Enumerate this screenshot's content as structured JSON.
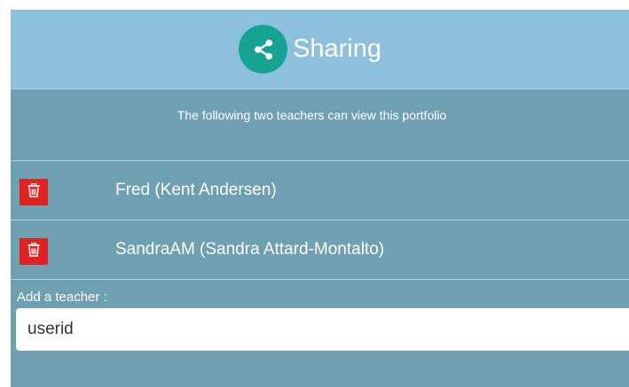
{
  "header": {
    "title": "Sharing",
    "icon": "share-icon",
    "icon_bg_color": "#17a394",
    "bg_color": "#8cc0dc"
  },
  "intro": {
    "text": "The following two teachers can view this portfolio"
  },
  "teachers": [
    {
      "name": "Fred (Kent Andersen)",
      "delete_icon": "trash-icon"
    },
    {
      "name": "SandraAM (Sandra Attard-Montalto)",
      "delete_icon": "trash-icon"
    }
  ],
  "add_teacher": {
    "label": "Add a teacher :",
    "value": "userid",
    "placeholder": ""
  },
  "colors": {
    "panel_bg": "#6fa0b2",
    "delete_button": "#e22222"
  }
}
